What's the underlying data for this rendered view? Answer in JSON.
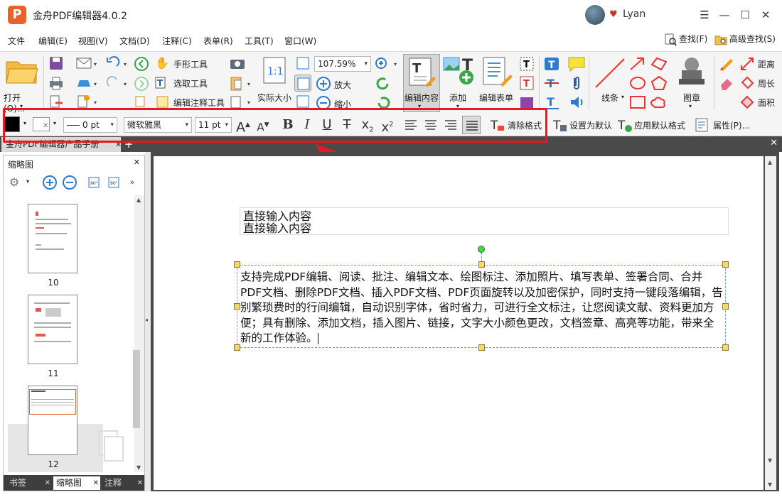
{
  "app": {
    "title": "金舟PDF编辑器4.0.2",
    "logo_letter": "P",
    "user": "Lyan",
    "accent": "#e8622c"
  },
  "window_controls": {
    "menu": "☰",
    "minimize": "—",
    "maximize": "☐",
    "close": "✕"
  },
  "menu": {
    "items": [
      "文件",
      "编辑(E)",
      "视图(V)",
      "文档(D)",
      "注释(C)",
      "表单(R)",
      "工具(T)",
      "窗口(W)"
    ],
    "find": "查找(F)",
    "advanced_find": "高级查找(S)"
  },
  "ribbon": {
    "open": "打开(O)...",
    "hand_tool": "手形工具",
    "select_tool": "选取工具",
    "edit_annot_tool": "编辑注释工具",
    "actual_size": "实际大小",
    "zoom_value": "107.59%",
    "zoom_in": "放大",
    "zoom_out": "缩小",
    "edit_content": "编辑内容",
    "add": "添加",
    "edit_form": "编辑表单",
    "line": "线条",
    "stamp": "图章",
    "distance": "距离",
    "perimeter": "周长",
    "area": "面积"
  },
  "format_bar": {
    "stroke_width": "0 pt",
    "font_name": "微软雅黑",
    "font_size": "11 pt",
    "clear_format": "清除格式",
    "set_default": "设置为默认",
    "apply_default": "应用默认格式",
    "properties": "属性(P)..."
  },
  "tabs": {
    "document": "金舟PDF编辑器产品手册"
  },
  "left_panel": {
    "title": "缩略图",
    "pages": [
      "10",
      "11",
      "12"
    ],
    "tabs": [
      "书签",
      "缩略图",
      "注释"
    ]
  },
  "document": {
    "line1": "直接输入内容",
    "line2": "直接输入内容",
    "paragraph": "支持完成PDF编辑、阅读、批注、编辑文本、绘图标注、添加照片、填写表单、签署合同、合并PDF文档、删除PDF文档、插入PDF文档、PDF页面旋转以及加密保护，同时支持一键段落编辑，告别繁琐费时的行间编辑，自动识别字体，省时省力，可进行全文标注，让您阅读文献、资料更加方便；具有删除、添加文档，插入图片、链接，文字大小颜色更改，文档签章、高亮等功能，带来全新的工作体验。"
  }
}
